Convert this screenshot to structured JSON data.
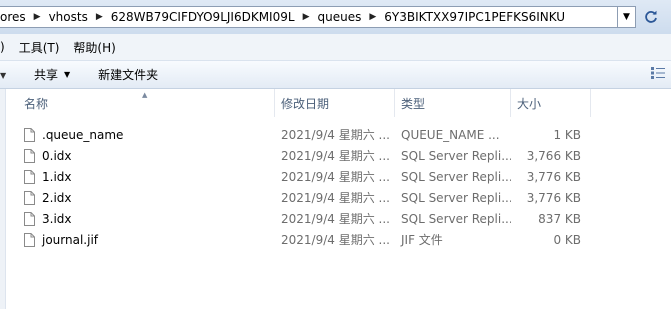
{
  "address": {
    "crumbs": [
      "ores",
      "vhosts",
      "628WB79CIFDYO9LJI6DKMI09L",
      "queues",
      "6Y3BIKTXX97IPC1PEFKS6INKU"
    ]
  },
  "menu": {
    "items": [
      ")",
      "工具(T)",
      "帮助(H)"
    ]
  },
  "toolbar": {
    "share_label": "共享",
    "new_folder_label": "新建文件夹"
  },
  "columns": {
    "name": "名称",
    "date": "修改日期",
    "type": "类型",
    "size": "大小"
  },
  "files": [
    {
      "name": ".queue_name",
      "date": "2021/9/4 星期六 ...",
      "type": "QUEUE_NAME ...",
      "size": "1 KB"
    },
    {
      "name": "0.idx",
      "date": "2021/9/4 星期六 ...",
      "type": "SQL Server Repli...",
      "size": "3,766 KB"
    },
    {
      "name": "1.idx",
      "date": "2021/9/4 星期六 ...",
      "type": "SQL Server Repli...",
      "size": "3,776 KB"
    },
    {
      "name": "2.idx",
      "date": "2021/9/4 星期六 ...",
      "type": "SQL Server Repli...",
      "size": "3,776 KB"
    },
    {
      "name": "3.idx",
      "date": "2021/9/4 星期六 ...",
      "type": "SQL Server Repli...",
      "size": "837 KB"
    },
    {
      "name": "journal.jif",
      "date": "2021/9/4 星期六 ...",
      "type": "JIF 文件",
      "size": "0 KB"
    }
  ]
}
